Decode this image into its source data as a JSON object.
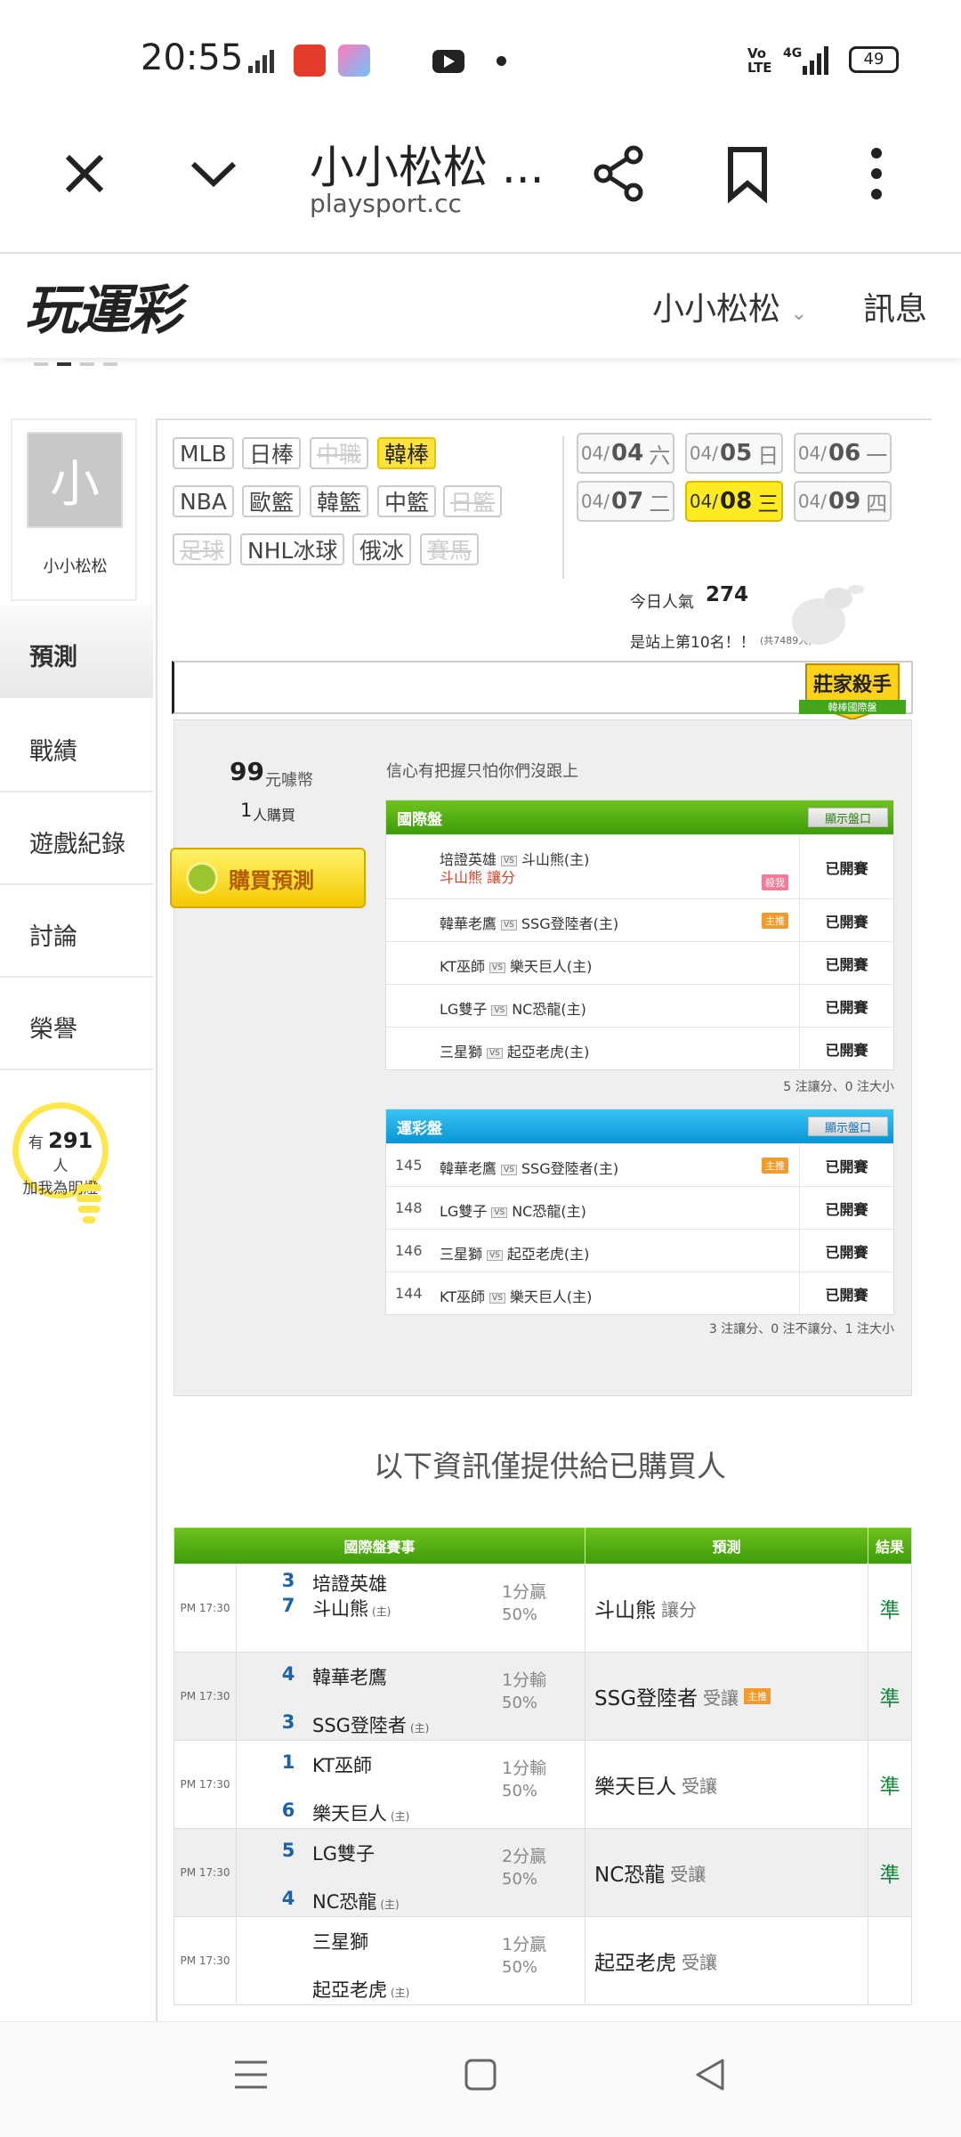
{
  "status_bar": {
    "time": "20:55",
    "battery": "49",
    "network": "4G"
  },
  "browser": {
    "title": "小小松松 ...",
    "url": "playsport.cc"
  },
  "site": {
    "logo": "玩運彩",
    "user_menu": "小小松松",
    "messages": "訊息"
  },
  "profile": {
    "avatar_char": "小",
    "name": "小小松松"
  },
  "sidebar": {
    "items": [
      {
        "label": "預測"
      },
      {
        "label": "戰績"
      },
      {
        "label": "遊戲紀錄"
      },
      {
        "label": "討論"
      },
      {
        "label": "榮譽"
      }
    ]
  },
  "bulb": {
    "prefix": "有",
    "count": "291",
    "suffix": "人",
    "line2": "加我為明燈"
  },
  "sports": {
    "row1": [
      "MLB",
      "日棒",
      "中職",
      "韓棒"
    ],
    "row2": [
      "NBA",
      "歐籃",
      "韓籃",
      "中籃",
      "日籃"
    ],
    "row3": [
      "足球",
      "NHL冰球",
      "俄冰",
      "賽馬"
    ]
  },
  "dates": [
    {
      "prefix": "04/",
      "day": "04",
      "week": "六"
    },
    {
      "prefix": "04/",
      "day": "05",
      "week": "日"
    },
    {
      "prefix": "04/",
      "day": "06",
      "week": "一"
    },
    {
      "prefix": "04/",
      "day": "07",
      "week": "二"
    },
    {
      "prefix": "04/",
      "day": "08",
      "week": "三"
    },
    {
      "prefix": "04/",
      "day": "09",
      "week": "四"
    }
  ],
  "popularity": {
    "label": "今日人氣",
    "value": "274",
    "rank": "是站上第10名！！",
    "note": "(共7489人)"
  },
  "badge": {
    "title": "莊家殺手",
    "sub": "韓棒國際盤"
  },
  "purchase": {
    "price": "99",
    "price_unit": "元噱幣",
    "buyers": "1",
    "buyers_unit": "人購買",
    "button": "購買預測",
    "slogan": "信心有把握只怕你們沒跟上"
  },
  "intl_table": {
    "title": "國際盤",
    "show_btn": "顯示盤口",
    "rows": [
      {
        "away": "培證英雄",
        "home": "斗山熊(主)",
        "pick": "斗山熊  讓分",
        "tag": "殺我",
        "status": "已開賽"
      },
      {
        "away": "韓華老鷹",
        "home": "SSG登陸者(主)",
        "tag": "主推",
        "status": "已開賽"
      },
      {
        "away": "KT巫師",
        "home": "樂天巨人(主)",
        "status": "已開賽"
      },
      {
        "away": "LG雙子",
        "home": "NC恐龍(主)",
        "status": "已開賽"
      },
      {
        "away": "三星獅",
        "home": "起亞老虎(主)",
        "status": "已開賽"
      }
    ],
    "note": "5 注讓分、0 注大小"
  },
  "lottery_table": {
    "title": "運彩盤",
    "show_btn": "顯示盤口",
    "rows": [
      {
        "num": "145",
        "away": "韓華老鷹",
        "home": "SSG登陸者(主)",
        "tag": "主推",
        "status": "已開賽"
      },
      {
        "num": "148",
        "away": "LG雙子",
        "home": "NC恐龍(主)",
        "status": "已開賽"
      },
      {
        "num": "146",
        "away": "三星獅",
        "home": "起亞老虎(主)",
        "status": "已開賽"
      },
      {
        "num": "144",
        "away": "KT巫師",
        "home": "樂天巨人(主)",
        "status": "已開賽"
      }
    ],
    "note": "3 注讓分、0 注不讓分、1 注大小"
  },
  "info_heading": "以下資訊僅提供給已購買人",
  "results": {
    "headers": [
      "國際盤賽事",
      "預測",
      "結果"
    ],
    "rows": [
      {
        "time": "PM 17:30",
        "away_score": "3",
        "away": "培證英雄",
        "home_score": "7",
        "home": "斗山熊",
        "home_mark": "(主)",
        "odds": "1分贏",
        "pct": "50%",
        "pred": "斗山熊",
        "pred_sub": "讓分",
        "tag": "",
        "result": "準"
      },
      {
        "time": "PM 17:30",
        "away_score": "4",
        "away": "韓華老鷹",
        "home_score": "3",
        "home": "SSG登陸者",
        "home_mark": "(主)",
        "odds": "1分輸",
        "pct": "50%",
        "pred": "SSG登陸者",
        "pred_sub": "受讓",
        "tag": "主推",
        "result": "準"
      },
      {
        "time": "PM 17:30",
        "away_score": "1",
        "away": "KT巫師",
        "home_score": "6",
        "home": "樂天巨人",
        "home_mark": "(主)",
        "odds": "1分輸",
        "pct": "50%",
        "pred": "樂天巨人",
        "pred_sub": "受讓",
        "tag": "",
        "result": "準"
      },
      {
        "time": "PM 17:30",
        "away_score": "5",
        "away": "LG雙子",
        "home_score": "4",
        "home": "NC恐龍",
        "home_mark": "(主)",
        "odds": "2分贏",
        "pct": "50%",
        "pred": "NC恐龍",
        "pred_sub": "受讓",
        "tag": "",
        "result": "準"
      },
      {
        "time": "PM 17:30",
        "away_score": "",
        "away": "三星獅",
        "home_score": "",
        "home": "起亞老虎",
        "home_mark": "(主)",
        "odds": "1分贏",
        "pct": "50%",
        "pred": "起亞老虎",
        "pred_sub": "受讓",
        "tag": "",
        "result": ""
      }
    ]
  },
  "colors": {
    "accent_green": "#3e9d0a",
    "accent_blue": "#0894d6",
    "highlight_yellow": "#ffe33a",
    "win_green": "#11873a"
  }
}
